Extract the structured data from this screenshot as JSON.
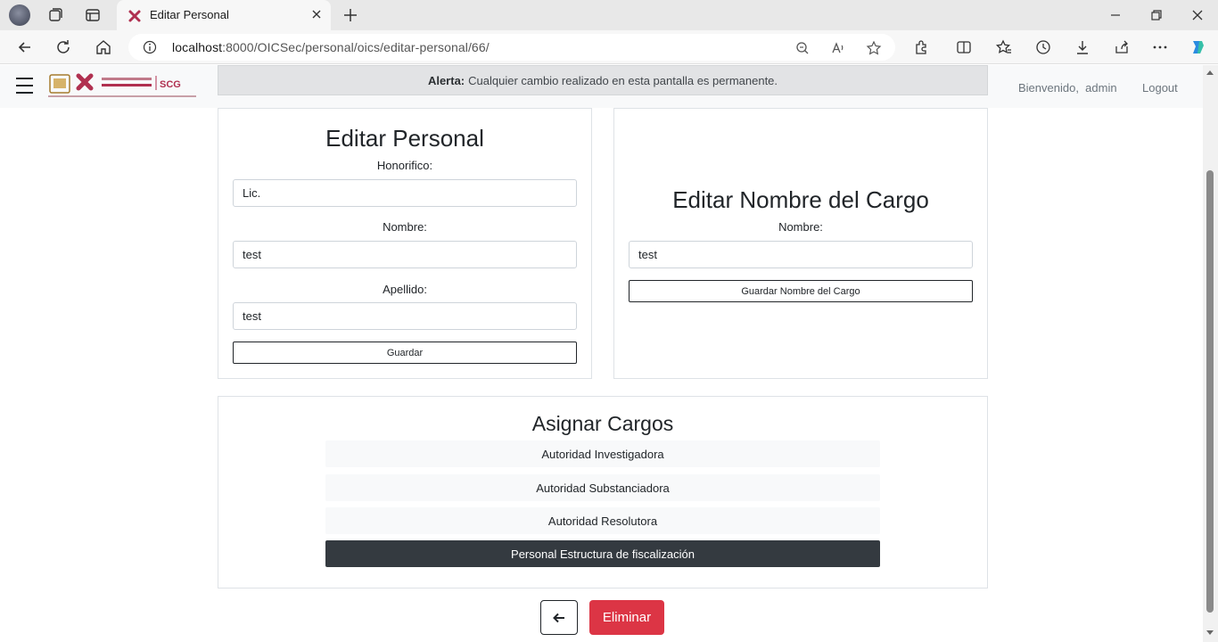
{
  "browser": {
    "tab_title": "Editar Personal",
    "url_host": "localhost",
    "url_path": ":8000/OICSec/personal/oics/editar-personal/66/"
  },
  "navbar": {
    "alert_label": "Alerta:",
    "alert_text": "Cualquier cambio realizado en esta pantalla es permanente.",
    "welcome_text": "Bienvenido,  admin",
    "logout_label": "Logout",
    "logo_text": "SCG"
  },
  "edit_personal": {
    "title": "Editar Personal",
    "honorifico_label": "Honorifico:",
    "honorifico_value": "Lic.",
    "nombre_label": "Nombre:",
    "nombre_value": "test",
    "apellido_label": "Apellido:",
    "apellido_value": "test",
    "save_label": "Guardar"
  },
  "edit_cargo": {
    "title": "Editar Nombre del Cargo",
    "nombre_label": "Nombre:",
    "nombre_value": "test",
    "save_label": "Guardar Nombre del Cargo"
  },
  "asignar_cargos": {
    "title": "Asignar Cargos",
    "items": [
      {
        "label": "Autoridad Investigadora",
        "active": false
      },
      {
        "label": "Autoridad Substanciadora",
        "active": false
      },
      {
        "label": "Autoridad Resolutora",
        "active": false
      },
      {
        "label": "Personal Estructura de fiscalización",
        "active": true
      }
    ]
  },
  "actions": {
    "back_icon": "arrow-left-icon",
    "delete_label": "Eliminar"
  },
  "colors": {
    "danger": "#dc3545",
    "active_item": "#343a40",
    "alert_bg": "#e2e3e5"
  }
}
